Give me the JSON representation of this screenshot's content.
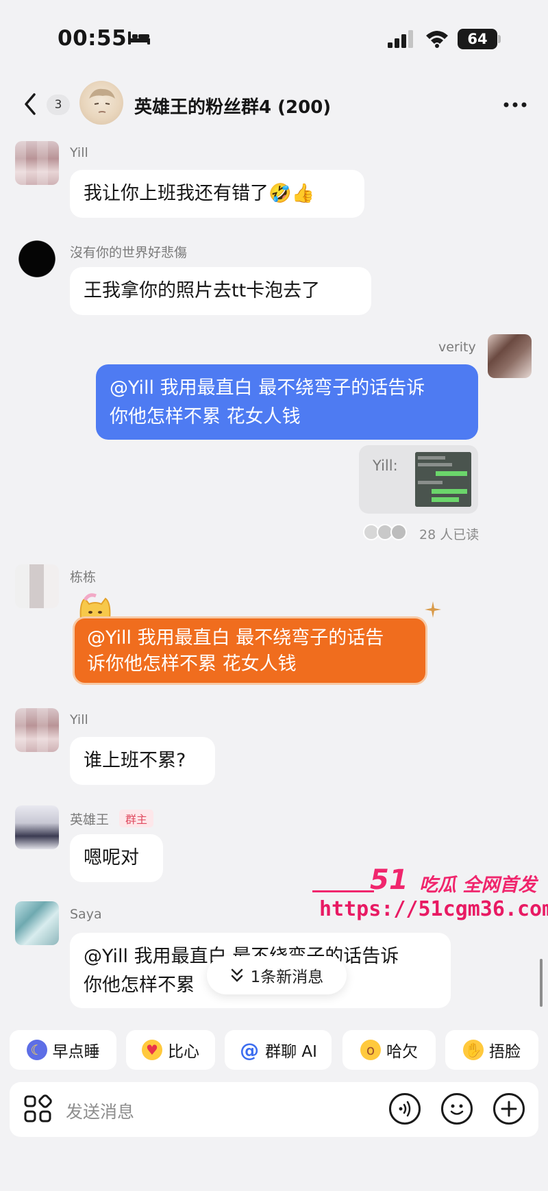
{
  "status": {
    "time": "00:55",
    "battery": "64"
  },
  "header": {
    "unread_count": "3",
    "title": "英雄王的粉丝群4 (200)"
  },
  "messages": [
    {
      "sender": "Yill",
      "text": "我让你上班我还有错了🤣👍"
    },
    {
      "sender": "沒有你的世界好悲傷",
      "text": "王我拿你的照片去tt卡泡去了"
    },
    {
      "sender": "verity",
      "text_line1": "@Yill 我用最直白 最不绕弯子的话告诉",
      "text_line2": "你他怎样不累 花女人钱"
    },
    {
      "image_card_label": "Yill:"
    },
    {
      "read_count": "28 人已读"
    },
    {
      "sender": "栋栋",
      "text_line1": "@Yill 我用最直白 最不绕弯子的话告",
      "text_line2": "诉你他怎样不累 花女人钱"
    },
    {
      "sender": "Yill",
      "text": "谁上班不累?"
    },
    {
      "sender": "英雄王",
      "role": "群主",
      "text": "嗯呢对"
    },
    {
      "sender": "Saya",
      "text_line1": "@Yill 我用最直白 最不绕弯子的话告诉",
      "text_line2": "你他怎样不累"
    }
  ],
  "new_messages": "1条新消息",
  "watermark": {
    "brand": "51",
    "title": "吃瓜 全网首发",
    "url": "https://51cgm36.com"
  },
  "quick_replies": [
    {
      "label": "早点睡",
      "icon": "sleep-emoji-icon"
    },
    {
      "label": "比心",
      "icon": "heart-hand-emoji-icon"
    },
    {
      "label": "群聊 AI",
      "icon": "at-icon"
    },
    {
      "label": "哈欠",
      "icon": "yawn-emoji-icon"
    },
    {
      "label": "捂脸",
      "icon": "facepalm-emoji-icon"
    }
  ],
  "input": {
    "placeholder": "发送消息"
  },
  "colors": {
    "blue_bubble": "#4e7bf2",
    "orange_bubble": "#f06d1e",
    "watermark": "#f0266d",
    "owner_badge": "#e04a5f"
  }
}
